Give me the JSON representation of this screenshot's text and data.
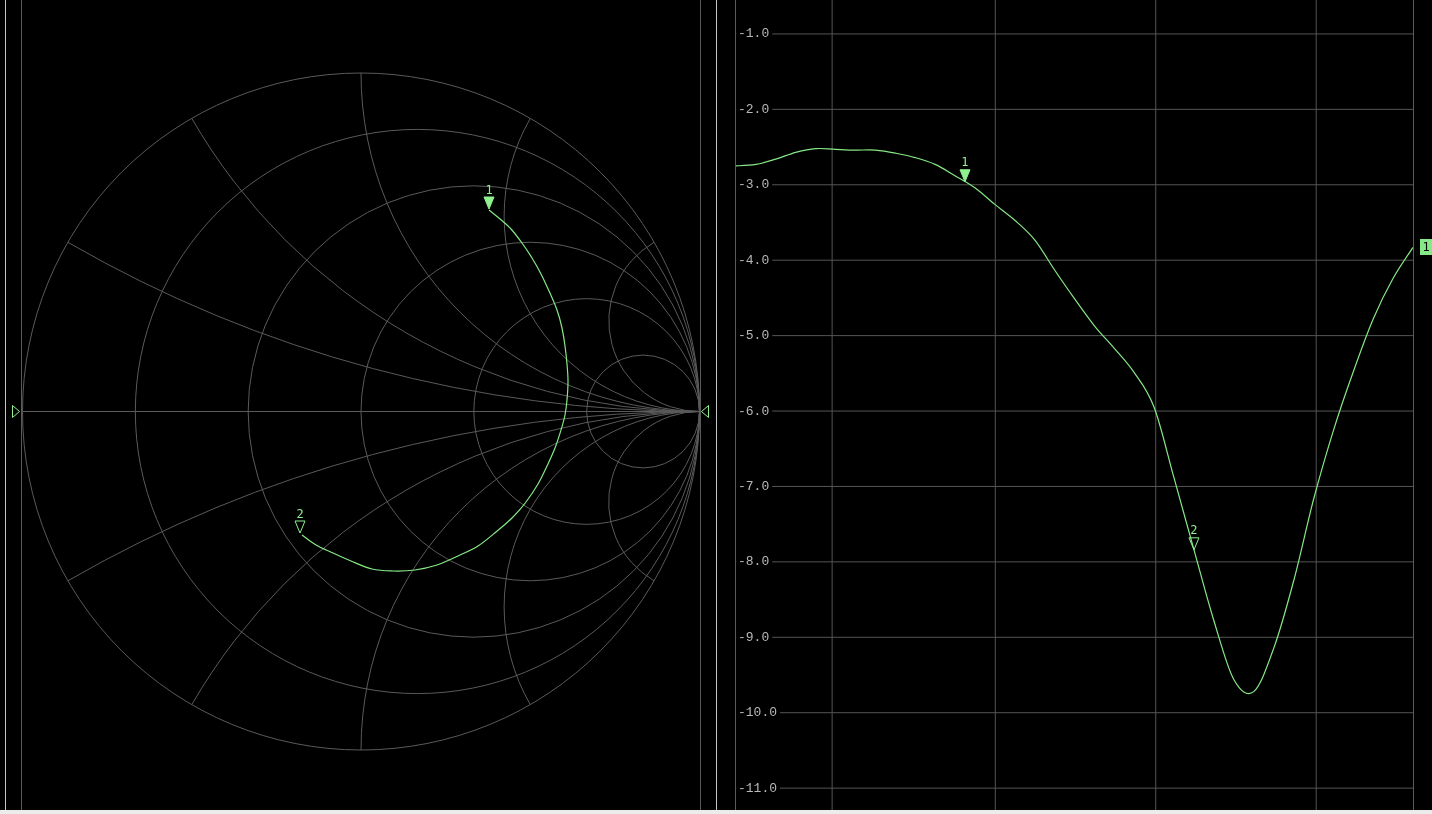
{
  "smith_chart": {
    "markers": [
      {
        "label": "1",
        "selected": true
      },
      {
        "label": "2",
        "selected": false
      }
    ]
  },
  "log_mag_chart": {
    "markers": [
      {
        "label": "1",
        "selected": true
      },
      {
        "label": "2",
        "selected": false
      }
    ],
    "chart_data": {
      "type": "line",
      "grid": true,
      "ylim": [
        -11.29,
        -0.55
      ],
      "yticks": [
        {
          "value": -1,
          "label": "-1.0"
        },
        {
          "value": -2,
          "label": "-2.0"
        },
        {
          "value": -3,
          "label": "-3.0"
        },
        {
          "value": -4,
          "label": "-4.0"
        },
        {
          "value": -5,
          "label": "-5.0"
        },
        {
          "value": -6,
          "label": "-6.0"
        },
        {
          "value": -7,
          "label": "-7.0"
        },
        {
          "value": -8,
          "label": "-8.0"
        },
        {
          "value": -9,
          "label": "-9.0"
        },
        {
          "value": -10,
          "label": "-10.0"
        },
        {
          "value": -11,
          "label": "-11.0"
        }
      ],
      "series": [
        {
          "name": "1",
          "color": "#86e886",
          "values": [
            -2.75,
            -2.73,
            -2.66,
            -2.57,
            -2.52,
            -2.53,
            -2.54,
            -2.54,
            -2.58,
            -2.64,
            -2.73,
            -2.88,
            -3.04,
            -3.26,
            -3.47,
            -3.73,
            -4.13,
            -4.51,
            -4.87,
            -5.17,
            -5.49,
            -5.95,
            -6.89,
            -7.84,
            -8.78,
            -9.56,
            -9.72,
            -9.15,
            -8.26,
            -7.18,
            -6.26,
            -5.48,
            -4.78,
            -4.24,
            -3.83
          ]
        }
      ]
    }
  }
}
